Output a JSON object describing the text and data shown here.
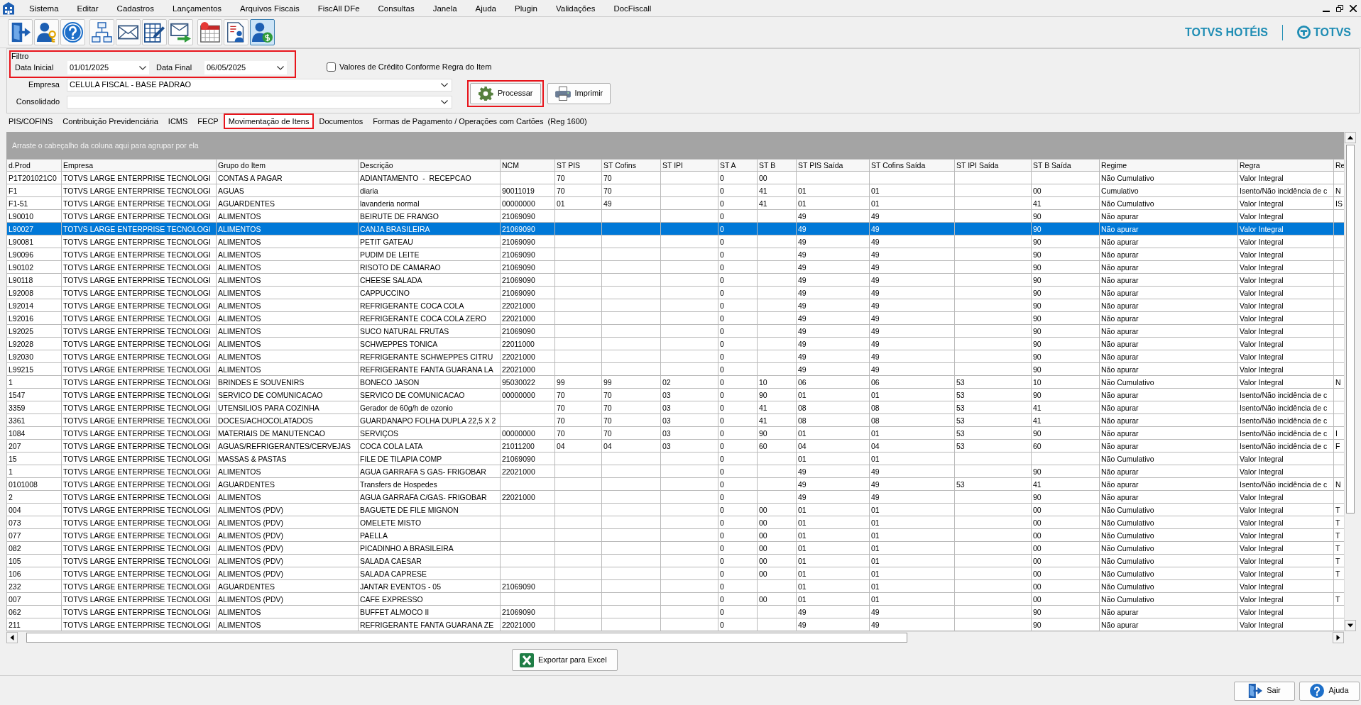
{
  "menu": [
    "Sistema",
    "Editar",
    "Cadastros",
    "Lançamentos",
    "Arquivos Fiscais",
    "FiscAll DFe",
    "Consultas",
    "Janela",
    "Ajuda",
    "Plugin",
    "Validações",
    "DocFiscall"
  ],
  "toolbar": [
    [
      {
        "pressed": false
      },
      {
        "pressed": false
      },
      {
        "pressed": false
      }
    ],
    [
      {
        "pressed": false
      },
      {
        "pressed": false
      },
      {
        "pressed": false
      },
      {
        "pressed": false
      }
    ],
    [
      {
        "pressed": false
      },
      {
        "pressed": false
      },
      {
        "pressed": true
      }
    ]
  ],
  "brand": {
    "product": "TOTVS HOTÉIS",
    "company": "TOTVS"
  },
  "filter": {
    "title": "Filtro",
    "highlighted": true,
    "date_start": {
      "label": "Data Inicial",
      "value": "01/01/2025"
    },
    "date_end": {
      "label": "Data Final",
      "value": "06/05/2025"
    },
    "credit_rule": {
      "label": "Valores de Crédito Conforme Regra do Item",
      "checked": false
    },
    "company": {
      "label": "Empresa",
      "value": "CELULA FISCAL - BASE PADRAO"
    },
    "consolidated": {
      "label": "Consolidado"
    }
  },
  "actions": [
    {
      "label": "Processar",
      "highlighted": true
    },
    {
      "label": "Imprimir",
      "highlighted": false
    }
  ],
  "tabs": [
    {
      "label": "PIS/COFINS",
      "selected": false,
      "highlighted": false
    },
    {
      "label": "Contribuição Previdenciária",
      "selected": false,
      "highlighted": false
    },
    {
      "label": "ICMS",
      "selected": false,
      "highlighted": false
    },
    {
      "label": "FECP",
      "selected": false,
      "highlighted": false
    },
    {
      "label": "Movimentação de Itens",
      "selected": true,
      "highlighted": true
    },
    {
      "label": "Documentos",
      "selected": false,
      "highlighted": false
    },
    {
      "label": "Formas de Pagamento / Operações com Cartões  (Reg 1600)",
      "selected": false,
      "highlighted": false
    }
  ],
  "table": {
    "group_hint": "Arraste o cabeçalho da coluna aqui para agrupar por ela",
    "columns": [
      "d.Prod",
      "Empresa",
      "Grupo do Item",
      "Descrição",
      "NCM",
      "ST PIS",
      "ST Cofins",
      "ST IPI",
      "ST A",
      "ST B",
      "ST PIS Saída",
      "ST Cofins Saída",
      "ST IPI Saída",
      "ST B Saída",
      "Regime",
      "Regra",
      "Re"
    ],
    "rows": [
      {
        "prod": "P1T201021C0",
        "empresa": "TOTVS LARGE ENTERPRISE TECNOLOGI",
        "grupo": "CONTAS A PAGAR",
        "descricao": "ADIANTAMENTO  -  RECEPCAO",
        "st_pis": "70",
        "st_cofins": "70",
        "st_a": "0",
        "st_b": "00",
        "regime": "Não Cumulativo",
        "regra": "Valor Integral",
        "selected": false
      },
      {
        "prod": "F1",
        "empresa": "TOTVS LARGE ENTERPRISE TECNOLOGI",
        "grupo": "AGUAS",
        "descricao": "diaria",
        "ncm": "90011019",
        "st_pis": "70",
        "st_cofins": "70",
        "st_a": "0",
        "st_b": "41",
        "st_pis_saida": "01",
        "st_cofins_saida": "01",
        "st_b_saida": "00",
        "regime": "Cumulativo",
        "regra": "Isento/Não incidência de c",
        "column_17": "N",
        "selected": false
      },
      {
        "prod": "F1-51",
        "empresa": "TOTVS LARGE ENTERPRISE TECNOLOGI",
        "grupo": "AGUARDENTES",
        "descricao": "lavanderia normal",
        "ncm": "00000000",
        "st_pis": "01",
        "st_cofins": "49",
        "st_a": "0",
        "st_b": "41",
        "st_pis_saida": "01",
        "st_cofins_saida": "01",
        "st_b_saida": "41",
        "regime": "Não Cumulativo",
        "regra": "Valor Integral",
        "column_17": "IS",
        "selected": false
      },
      {
        "prod": "L90010",
        "empresa": "TOTVS LARGE ENTERPRISE TECNOLOGI",
        "grupo": "ALIMENTOS",
        "descricao": "BEIRUTE DE FRANGO",
        "ncm": "21069090",
        "st_a": "0",
        "st_pis_saida": "49",
        "st_cofins_saida": "49",
        "st_b_saida": "90",
        "regime": "Não apurar",
        "regra": "Valor Integral",
        "selected": false
      },
      {
        "prod": "L90027",
        "empresa": "TOTVS LARGE ENTERPRISE TECNOLOGI",
        "grupo": "ALIMENTOS",
        "descricao": "CANJA BRASILEIRA",
        "ncm": "21069090",
        "st_a": "0",
        "st_pis_saida": "49",
        "st_cofins_saida": "49",
        "st_b_saida": "90",
        "regime": "Não apurar",
        "regra": "Valor Integral",
        "selected": true
      },
      {
        "prod": "L90081",
        "empresa": "TOTVS LARGE ENTERPRISE TECNOLOGI",
        "grupo": "ALIMENTOS",
        "descricao": "PETIT GATEAU",
        "ncm": "21069090",
        "st_a": "0",
        "st_pis_saida": "49",
        "st_cofins_saida": "49",
        "st_b_saida": "90",
        "regime": "Não apurar",
        "regra": "Valor Integral",
        "selected": false
      },
      {
        "prod": "L90096",
        "empresa": "TOTVS LARGE ENTERPRISE TECNOLOGI",
        "grupo": "ALIMENTOS",
        "descricao": "PUDIM DE LEITE",
        "ncm": "21069090",
        "st_a": "0",
        "st_pis_saida": "49",
        "st_cofins_saida": "49",
        "st_b_saida": "90",
        "regime": "Não apurar",
        "regra": "Valor Integral",
        "selected": false
      },
      {
        "prod": "L90102",
        "empresa": "TOTVS LARGE ENTERPRISE TECNOLOGI",
        "grupo": "ALIMENTOS",
        "descricao": "RISOTO DE CAMARAO",
        "ncm": "21069090",
        "st_a": "0",
        "st_pis_saida": "49",
        "st_cofins_saida": "49",
        "st_b_saida": "90",
        "regime": "Não apurar",
        "regra": "Valor Integral",
        "selected": false
      },
      {
        "prod": "L90118",
        "empresa": "TOTVS LARGE ENTERPRISE TECNOLOGI",
        "grupo": "ALIMENTOS",
        "descricao": "CHEESE SALADA",
        "ncm": "21069090",
        "st_a": "0",
        "st_pis_saida": "49",
        "st_cofins_saida": "49",
        "st_b_saida": "90",
        "regime": "Não apurar",
        "regra": "Valor Integral",
        "selected": false
      },
      {
        "prod": "L92008",
        "empresa": "TOTVS LARGE ENTERPRISE TECNOLOGI",
        "grupo": "ALIMENTOS",
        "descricao": "CAPPUCCINO",
        "ncm": "21069090",
        "st_a": "0",
        "st_pis_saida": "49",
        "st_cofins_saida": "49",
        "st_b_saida": "90",
        "regime": "Não apurar",
        "regra": "Valor Integral",
        "selected": false
      },
      {
        "prod": "L92014",
        "empresa": "TOTVS LARGE ENTERPRISE TECNOLOGI",
        "grupo": "ALIMENTOS",
        "descricao": "REFRIGERANTE COCA COLA",
        "ncm": "22021000",
        "st_a": "0",
        "st_pis_saida": "49",
        "st_cofins_saida": "49",
        "st_b_saida": "90",
        "regime": "Não apurar",
        "regra": "Valor Integral",
        "selected": false
      },
      {
        "prod": "L92016",
        "empresa": "TOTVS LARGE ENTERPRISE TECNOLOGI",
        "grupo": "ALIMENTOS",
        "descricao": "REFRIGERANTE COCA COLA ZERO",
        "ncm": "22021000",
        "st_a": "0",
        "st_pis_saida": "49",
        "st_cofins_saida": "49",
        "st_b_saida": "90",
        "regime": "Não apurar",
        "regra": "Valor Integral",
        "selected": false
      },
      {
        "prod": "L92025",
        "empresa": "TOTVS LARGE ENTERPRISE TECNOLOGI",
        "grupo": "ALIMENTOS",
        "descricao": "SUCO NATURAL FRUTAS",
        "ncm": "21069090",
        "st_a": "0",
        "st_pis_saida": "49",
        "st_cofins_saida": "49",
        "st_b_saida": "90",
        "regime": "Não apurar",
        "regra": "Valor Integral",
        "selected": false
      },
      {
        "prod": "L92028",
        "empresa": "TOTVS LARGE ENTERPRISE TECNOLOGI",
        "grupo": "ALIMENTOS",
        "descricao": "SCHWEPPES TONICA",
        "ncm": "22011000",
        "st_a": "0",
        "st_pis_saida": "49",
        "st_cofins_saida": "49",
        "st_b_saida": "90",
        "regime": "Não apurar",
        "regra": "Valor Integral",
        "selected": false
      },
      {
        "prod": "L92030",
        "empresa": "TOTVS LARGE ENTERPRISE TECNOLOGI",
        "grupo": "ALIMENTOS",
        "descricao": "REFRIGERANTE SCHWEPPES CITRU",
        "ncm": "22021000",
        "st_a": "0",
        "st_pis_saida": "49",
        "st_cofins_saida": "49",
        "st_b_saida": "90",
        "regime": "Não apurar",
        "regra": "Valor Integral",
        "selected": false
      },
      {
        "prod": "L99215",
        "empresa": "TOTVS LARGE ENTERPRISE TECNOLOGI",
        "grupo": "ALIMENTOS",
        "descricao": "REFRIGERANTE FANTA GUARANA LA",
        "ncm": "22021000",
        "st_a": "0",
        "st_pis_saida": "49",
        "st_cofins_saida": "49",
        "st_b_saida": "90",
        "regime": "Não apurar",
        "regra": "Valor Integral",
        "selected": false
      },
      {
        "prod": "1",
        "empresa": "TOTVS LARGE ENTERPRISE TECNOLOGI",
        "grupo": "BRINDES E SOUVENIRS",
        "descricao": "BONECO JASON",
        "ncm": "95030022",
        "st_pis": "99",
        "st_cofins": "99",
        "st_ipi": "02",
        "st_a": "0",
        "st_b": "10",
        "st_pis_saida": "06",
        "st_cofins_saida": "06",
        "st_ipi_saida": "53",
        "st_b_saida": "10",
        "regime": "Não Cumulativo",
        "regra": "Valor Integral",
        "column_17": "N",
        "selected": false
      },
      {
        "prod": "1547",
        "empresa": "TOTVS LARGE ENTERPRISE TECNOLOGI",
        "grupo": "SERVICO DE COMUNICACAO",
        "descricao": "SERVICO DE COMUNICACAO",
        "ncm": "00000000",
        "st_pis": "70",
        "st_cofins": "70",
        "st_ipi": "03",
        "st_a": "0",
        "st_b": "90",
        "st_pis_saida": "01",
        "st_cofins_saida": "01",
        "st_ipi_saida": "53",
        "st_b_saida": "90",
        "regime": "Não apurar",
        "regra": "Isento/Não incidência de c",
        "selected": false
      },
      {
        "prod": "3359",
        "empresa": "TOTVS LARGE ENTERPRISE TECNOLOGI",
        "grupo": "UTENSILIOS PARA COZINHA",
        "descricao": "Gerador de 60g/h de ozonio",
        "st_pis": "70",
        "st_cofins": "70",
        "st_ipi": "03",
        "st_a": "0",
        "st_b": "41",
        "st_pis_saida": "08",
        "st_cofins_saida": "08",
        "st_ipi_saida": "53",
        "st_b_saida": "41",
        "regime": "Não apurar",
        "regra": "Isento/Não incidência de c",
        "selected": false
      },
      {
        "prod": "3361",
        "empresa": "TOTVS LARGE ENTERPRISE TECNOLOGI",
        "grupo": "DOCES/ACHOCOLATADOS",
        "descricao": "GUARDANAPO FOLHA DUPLA 22,5 X 2",
        "st_pis": "70",
        "st_cofins": "70",
        "st_ipi": "03",
        "st_a": "0",
        "st_b": "41",
        "st_pis_saida": "08",
        "st_cofins_saida": "08",
        "st_ipi_saida": "53",
        "st_b_saida": "41",
        "regime": "Não apurar",
        "regra": "Isento/Não incidência de c",
        "selected": false
      },
      {
        "prod": "1084",
        "empresa": "TOTVS LARGE ENTERPRISE TECNOLOGI",
        "grupo": "MATERIAIS DE MANUTENCAO",
        "descricao": "SERVIÇOS",
        "ncm": "00000000",
        "st_pis": "70",
        "st_cofins": "70",
        "st_ipi": "03",
        "st_a": "0",
        "st_b": "90",
        "st_pis_saida": "01",
        "st_cofins_saida": "01",
        "st_ipi_saida": "53",
        "st_b_saida": "90",
        "regime": "Não apurar",
        "regra": "Isento/Não incidência de c",
        "column_17": "I",
        "selected": false
      },
      {
        "prod": "207",
        "empresa": "TOTVS LARGE ENTERPRISE TECNOLOGI",
        "grupo": "AGUAS/REFRIGERANTES/CERVEJAS",
        "descricao": "COCA COLA LATA",
        "ncm": "21011200",
        "st_pis": "04",
        "st_cofins": "04",
        "st_ipi": "03",
        "st_a": "0",
        "st_b": "60",
        "st_pis_saida": "04",
        "st_cofins_saida": "04",
        "st_ipi_saida": "53",
        "st_b_saida": "60",
        "regime": "Não apurar",
        "regra": "Isento/Não incidência de c",
        "column_17": "F",
        "selected": false
      },
      {
        "prod": "15",
        "empresa": "TOTVS LARGE ENTERPRISE TECNOLOGI",
        "grupo": "MASSAS & PASTAS",
        "descricao": "FILE DE TILAPIA COMP",
        "ncm": "21069090",
        "st_a": "0",
        "st_pis_saida": "01",
        "st_cofins_saida": "01",
        "regime": "Não Cumulativo",
        "regra": "Valor Integral",
        "selected": false
      },
      {
        "prod": "1",
        "empresa": "TOTVS LARGE ENTERPRISE TECNOLOGI",
        "grupo": "ALIMENTOS",
        "descricao": "AGUA GARRAFA S GAS- FRIGOBAR",
        "ncm": "22021000",
        "st_a": "0",
        "st_pis_saida": "49",
        "st_cofins_saida": "49",
        "st_b_saida": "90",
        "regime": "Não apurar",
        "regra": "Valor Integral",
        "selected": false
      },
      {
        "prod": "0101008",
        "empresa": "TOTVS LARGE ENTERPRISE TECNOLOGI",
        "grupo": "AGUARDENTES",
        "descricao": "Transfers de Hospedes",
        "st_a": "0",
        "st_pis_saida": "49",
        "st_cofins_saida": "49",
        "st_ipi_saida": "53",
        "st_b_saida": "41",
        "regime": "Não apurar",
        "regra": "Isento/Não incidência de c",
        "column_17": "N",
        "selected": false
      },
      {
        "prod": "2",
        "empresa": "TOTVS LARGE ENTERPRISE TECNOLOGI",
        "grupo": "ALIMENTOS",
        "descricao": "AGUA GARRAFA C/GAS- FRIGOBAR",
        "ncm": "22021000",
        "st_a": "0",
        "st_pis_saida": "49",
        "st_cofins_saida": "49",
        "st_b_saida": "90",
        "regime": "Não apurar",
        "regra": "Valor Integral",
        "selected": false
      },
      {
        "prod": "004",
        "empresa": "TOTVS LARGE ENTERPRISE TECNOLOGI",
        "grupo": "ALIMENTOS (PDV)",
        "descricao": "BAGUETE DE FILE MIGNON",
        "st_a": "0",
        "st_b": "00",
        "st_pis_saida": "01",
        "st_cofins_saida": "01",
        "st_b_saida": "00",
        "regime": "Não Cumulativo",
        "regra": "Valor Integral",
        "column_17": "T",
        "selected": false
      },
      {
        "prod": "073",
        "empresa": "TOTVS LARGE ENTERPRISE TECNOLOGI",
        "grupo": "ALIMENTOS (PDV)",
        "descricao": "OMELETE MISTO",
        "st_a": "0",
        "st_b": "00",
        "st_pis_saida": "01",
        "st_cofins_saida": "01",
        "st_b_saida": "00",
        "regime": "Não Cumulativo",
        "regra": "Valor Integral",
        "column_17": "T",
        "selected": false
      },
      {
        "prod": "077",
        "empresa": "TOTVS LARGE ENTERPRISE TECNOLOGI",
        "grupo": "ALIMENTOS (PDV)",
        "descricao": "PAELLA",
        "st_a": "0",
        "st_b": "00",
        "st_pis_saida": "01",
        "st_cofins_saida": "01",
        "st_b_saida": "00",
        "regime": "Não Cumulativo",
        "regra": "Valor Integral",
        "column_17": "T",
        "selected": false
      },
      {
        "prod": "082",
        "empresa": "TOTVS LARGE ENTERPRISE TECNOLOGI",
        "grupo": "ALIMENTOS (PDV)",
        "descricao": "PICADINHO A BRASILEIRA",
        "st_a": "0",
        "st_b": "00",
        "st_pis_saida": "01",
        "st_cofins_saida": "01",
        "st_b_saida": "00",
        "regime": "Não Cumulativo",
        "regra": "Valor Integral",
        "column_17": "T",
        "selected": false
      },
      {
        "prod": "105",
        "empresa": "TOTVS LARGE ENTERPRISE TECNOLOGI",
        "grupo": "ALIMENTOS (PDV)",
        "descricao": "SALADA CAESAR",
        "st_a": "0",
        "st_b": "00",
        "st_pis_saida": "01",
        "st_cofins_saida": "01",
        "st_b_saida": "00",
        "regime": "Não Cumulativo",
        "regra": "Valor Integral",
        "column_17": "T",
        "selected": false
      },
      {
        "prod": "106",
        "empresa": "TOTVS LARGE ENTERPRISE TECNOLOGI",
        "grupo": "ALIMENTOS (PDV)",
        "descricao": "SALADA CAPRESE",
        "st_a": "0",
        "st_b": "00",
        "st_pis_saida": "01",
        "st_cofins_saida": "01",
        "st_b_saida": "00",
        "regime": "Não Cumulativo",
        "regra": "Valor Integral",
        "column_17": "T",
        "selected": false
      },
      {
        "prod": "232",
        "empresa": "TOTVS LARGE ENTERPRISE TECNOLOGI",
        "grupo": "AGUARDENTES",
        "descricao": "JANTAR EVENTOS - 05",
        "ncm": "21069090",
        "st_a": "0",
        "st_pis_saida": "01",
        "st_cofins_saida": "01",
        "st_b_saida": "00",
        "regime": "Não Cumulativo",
        "regra": "Valor Integral",
        "selected": false
      },
      {
        "prod": "007",
        "empresa": "TOTVS LARGE ENTERPRISE TECNOLOGI",
        "grupo": "ALIMENTOS (PDV)",
        "descricao": "CAFE EXPRESSO",
        "st_a": "0",
        "st_b": "00",
        "st_pis_saida": "01",
        "st_cofins_saida": "01",
        "st_b_saida": "00",
        "regime": "Não Cumulativo",
        "regra": "Valor Integral",
        "column_17": "T",
        "selected": false
      },
      {
        "prod": "062",
        "empresa": "TOTVS LARGE ENTERPRISE TECNOLOGI",
        "grupo": "ALIMENTOS",
        "descricao": "BUFFET ALMOCO II",
        "ncm": "21069090",
        "st_a": "0",
        "st_pis_saida": "49",
        "st_cofins_saida": "49",
        "st_b_saida": "90",
        "regime": "Não apurar",
        "regra": "Valor Integral",
        "selected": false
      },
      {
        "prod": "211",
        "empresa": "TOTVS LARGE ENTERPRISE TECNOLOGI",
        "grupo": "ALIMENTOS",
        "descricao": "REFRIGERANTE FANTA GUARANA ZE",
        "ncm": "22021000",
        "st_a": "0",
        "st_pis_saida": "49",
        "st_cofins_saida": "49",
        "st_b_saida": "90",
        "regime": "Não apurar",
        "regra": "Valor Integral",
        "selected": false
      }
    ]
  },
  "export_button": {
    "label": "Exportar para Excel"
  },
  "footer_buttons": [
    {
      "label": "Sair"
    },
    {
      "label": "Ajuda"
    }
  ]
}
